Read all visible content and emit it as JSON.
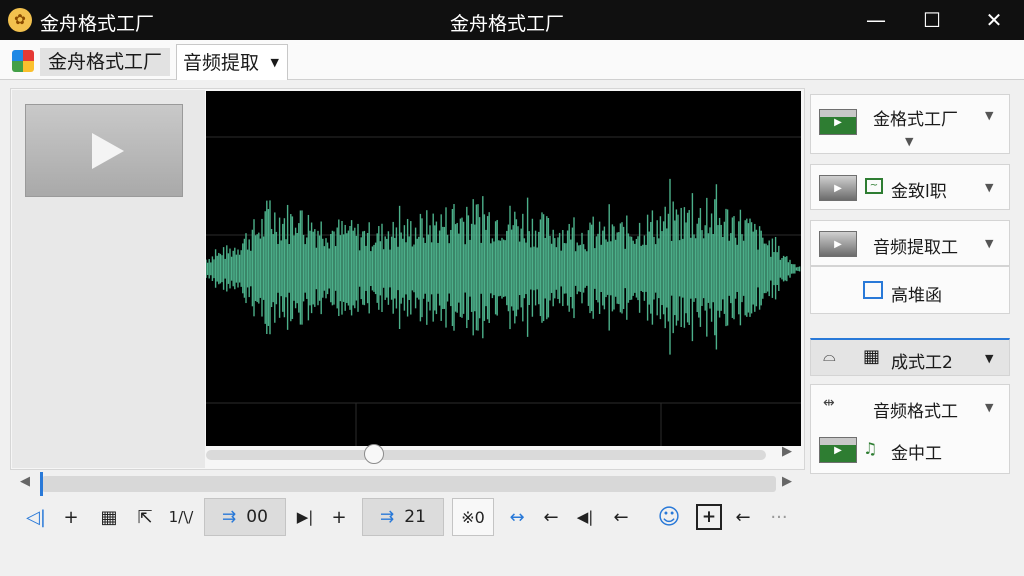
{
  "window": {
    "app_title": "金舟格式工厂",
    "title": "金舟格式工厂",
    "minimize": "—",
    "maximize": "☐",
    "close": "✕"
  },
  "tabs": {
    "home": "金舟格式工厂",
    "audio": "音频提取",
    "audio_caret": "▼"
  },
  "toolbar": {
    "volume_icon": "◁|",
    "plus1": "+",
    "grid_icon": "▦",
    "cursor_icon": "⇱",
    "split_label": "1/\\/",
    "start_icon": "⇉",
    "start_value": "00",
    "mark_in_icon": "▶|",
    "plus2": "+",
    "end_icon": "⇉",
    "end_value": "21",
    "mute_label": "※0",
    "loop_icon": "↔",
    "arrow1": "←",
    "prev_icon": "◀|",
    "arrow2": "←",
    "user_icon": "☺",
    "add_box": "+",
    "arrow3": "←",
    "more": "···"
  },
  "right_panel": {
    "item1": {
      "label": "金格式工厂",
      "caret": "▼",
      "sub_caret": "▼"
    },
    "item2": {
      "label": "金致l职",
      "caret": "▼"
    },
    "item3": {
      "label": "音频提取工",
      "caret": "▼",
      "sub_label": "高堆函"
    },
    "item4": {
      "label": "成式工2",
      "caret": "▼"
    },
    "item5": {
      "label": "音频格式工",
      "caret": "▼",
      "sub_label": "金中工"
    }
  },
  "colors": {
    "accent": "#2979d8",
    "waveform": "#4cb08a",
    "wave_bg": "#000000",
    "titlebar": "#101010"
  },
  "scroll": {
    "position_fraction": 0.28
  }
}
